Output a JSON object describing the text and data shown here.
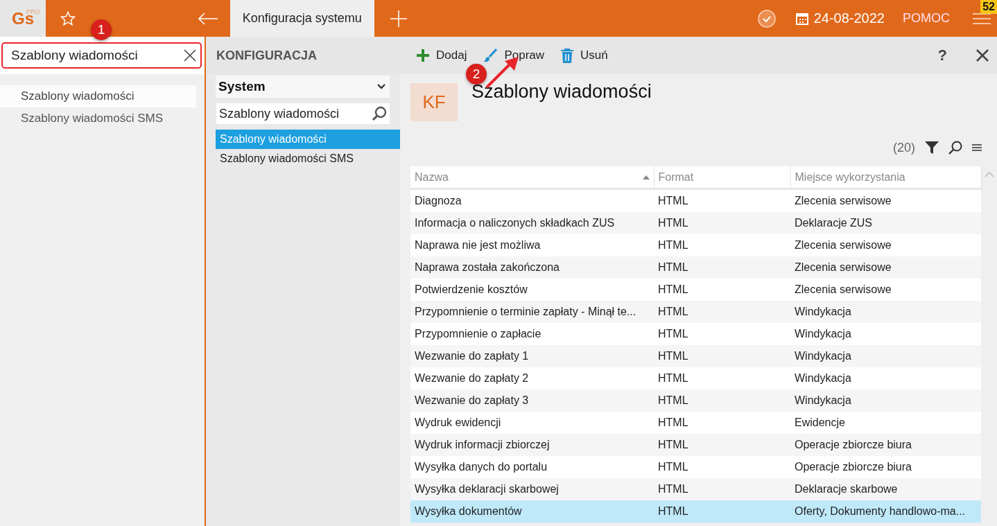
{
  "topbar": {
    "logo": "Gs",
    "logo_sup": "PRO",
    "tab": {
      "label": "Konfiguracja systemu",
      "selected": true
    },
    "date": "24-08-2022",
    "help": "POMOC",
    "badge": "52"
  },
  "sidebar": {
    "search": {
      "value": "Szablony wiadomości",
      "highlighted": true
    },
    "results": [
      {
        "label": "Szablony wiadomości",
        "selected": true
      },
      {
        "label": "Szablony wiadomości SMS",
        "selected": false
      }
    ]
  },
  "config": {
    "title": "KONFIGURACJA",
    "dropdown": "System",
    "search": {
      "value": "Szablony wiadomości"
    },
    "items": [
      {
        "label": "Szablony wiadomości",
        "selected": true
      },
      {
        "label": "Szablony wiadomości SMS",
        "selected": false
      }
    ]
  },
  "toolbar": {
    "buttons": [
      {
        "kind": "add",
        "label": "Dodaj"
      },
      {
        "kind": "edit",
        "label": "Popraw"
      },
      {
        "kind": "delete",
        "label": "Usuń"
      }
    ],
    "help": "?"
  },
  "content": {
    "avatar": "KF",
    "title": "Szablony wiadomości",
    "count": "(20)"
  },
  "table": {
    "columns": [
      {
        "label": "Nazwa",
        "sorted": true
      },
      {
        "label": "Format",
        "sorted": false
      },
      {
        "label": "Miejsce wykorzystania",
        "sorted": false
      }
    ],
    "rows": [
      {
        "cells": [
          "Diagnoza",
          "HTML",
          "Zlecenia serwisowe"
        ],
        "selected": false
      },
      {
        "cells": [
          "Informacja o naliczonych składkach ZUS",
          "HTML",
          "Deklaracje ZUS"
        ],
        "selected": false
      },
      {
        "cells": [
          "Naprawa nie jest możliwa",
          "HTML",
          "Zlecenia serwisowe"
        ],
        "selected": false
      },
      {
        "cells": [
          "Naprawa została zakończona",
          "HTML",
          "Zlecenia serwisowe"
        ],
        "selected": false
      },
      {
        "cells": [
          "Potwierdzenie kosztów",
          "HTML",
          "Zlecenia serwisowe"
        ],
        "selected": false
      },
      {
        "cells": [
          "Przypomnienie o terminie zapłaty - Minął te...",
          "HTML",
          "Windykacja"
        ],
        "selected": false
      },
      {
        "cells": [
          "Przypomnienie o zapłacie",
          "HTML",
          "Windykacja"
        ],
        "selected": false
      },
      {
        "cells": [
          "Wezwanie do zapłaty 1",
          "HTML",
          "Windykacja"
        ],
        "selected": false
      },
      {
        "cells": [
          "Wezwanie do zapłaty 2",
          "HTML",
          "Windykacja"
        ],
        "selected": false
      },
      {
        "cells": [
          "Wezwanie do zapłaty 3",
          "HTML",
          "Windykacja"
        ],
        "selected": false
      },
      {
        "cells": [
          "Wydruk ewidencji",
          "HTML",
          "Ewidencje"
        ],
        "selected": false
      },
      {
        "cells": [
          "Wydruk informacji zbiorczej",
          "HTML",
          "Operacje zbiorcze biura"
        ],
        "selected": false
      },
      {
        "cells": [
          "Wysyłka danych do portalu",
          "HTML",
          "Operacje zbiorcze biura"
        ],
        "selected": false
      },
      {
        "cells": [
          "Wysyłka deklaracji skarbowej",
          "HTML",
          "Deklaracje skarbowe"
        ],
        "selected": false
      },
      {
        "cells": [
          "Wysyłka dokumentów",
          "HTML",
          "Oferty, Dokumenty handlowo-ma..."
        ],
        "selected": true
      }
    ]
  },
  "callouts": [
    {
      "label": "1",
      "arrow": false
    },
    {
      "label": "2",
      "arrow": true
    }
  ]
}
